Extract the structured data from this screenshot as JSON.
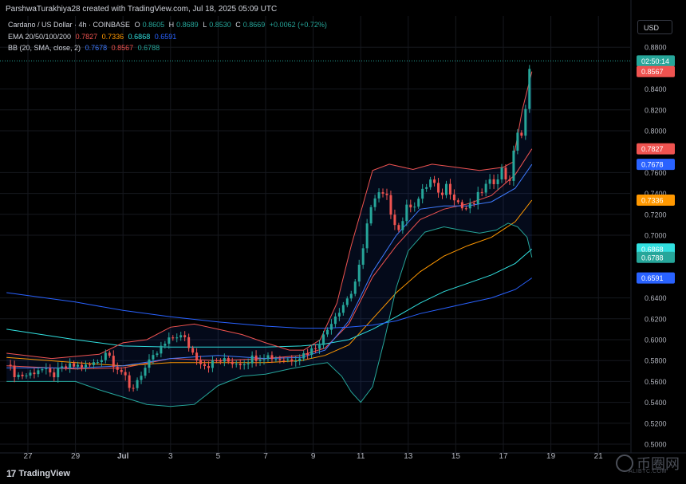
{
  "header": {
    "text": "ParshwaTurakhiya28 created with TradingView.com, Jul 18, 2025 05:09 UTC"
  },
  "legend": {
    "symbol": "Cardano / US Dollar · 4h · COINBASE",
    "o_label": "O",
    "o": "0.8605",
    "h_label": "H",
    "h": "0.8689",
    "l_label": "L",
    "l": "0.8530",
    "c_label": "C",
    "c": "0.8669",
    "change": "+0.0062 (+0.72%)",
    "ema_label": "EMA 20/50/100/200",
    "ema20": "0.7827",
    "ema50": "0.7336",
    "ema100": "0.6868",
    "ema200": "0.6591",
    "bb_label": "BB (20, SMA, close, 2)",
    "bb_basis": "0.7678",
    "bb_upper": "0.8567",
    "bb_lower": "0.6788"
  },
  "currency": "USD",
  "footer": {
    "logo_text": "TradingView",
    "logo_mark": "17"
  },
  "watermark": {
    "main": "币圈网",
    "sub": "ALIBTC.COM"
  },
  "colors": {
    "up": "#26a69a",
    "down": "#ef5350",
    "ema20": "#ef5350",
    "ema50": "#ff9800",
    "ema100": "#31e0e0",
    "ema200": "#2962ff",
    "bb_basis": "#3f7bff",
    "bb_upper": "#ef5350",
    "bb_lower": "#26a69a"
  },
  "chart_data": {
    "type": "candlestick",
    "title": "Cardano / US Dollar · 4h · COINBASE",
    "xlabel": "",
    "ylabel": "",
    "ylim": [
      0.49,
      0.895
    ],
    "y_ticks": [
      "0.8800",
      "0.8400",
      "0.8200",
      "0.8000",
      "0.7600",
      "0.7400",
      "0.7200",
      "0.7000",
      "0.6400",
      "0.6200",
      "0.6000",
      "0.5800",
      "0.5600",
      "0.5400",
      "0.5200",
      "0.5000"
    ],
    "x_tick_labels": [
      "27",
      "29",
      "Jul",
      "3",
      "5",
      "7",
      "9",
      "11",
      "13",
      "15",
      "17",
      "19",
      "21"
    ],
    "x_tick_days": [
      0,
      2,
      4,
      6,
      8,
      10,
      12,
      14,
      16,
      18,
      20,
      22,
      24
    ],
    "last_day": 21.2,
    "price_tags": [
      {
        "text": "02:50:14",
        "value": 0.8669,
        "color": "#26a69a"
      },
      {
        "text": "0.8567",
        "value": 0.8567,
        "color": "#ef5350"
      },
      {
        "text": "0.7827",
        "value": 0.7827,
        "color": "#ef5350"
      },
      {
        "text": "0.7678",
        "value": 0.7678,
        "color": "#2962ff"
      },
      {
        "text": "0.7336",
        "value": 0.7336,
        "color": "#ff9800"
      },
      {
        "text": "0.6868",
        "value": 0.6868,
        "color": "#31e0e0"
      },
      {
        "text": "0.6788",
        "value": 0.6788,
        "color": "#26a69a"
      },
      {
        "text": "0.6591",
        "value": 0.6591,
        "color": "#2962ff"
      }
    ],
    "close_path": [
      [
        -0.9,
        0.576
      ],
      [
        -0.5,
        0.566
      ],
      [
        0,
        0.566
      ],
      [
        0.5,
        0.573
      ],
      [
        1,
        0.565
      ],
      [
        1.5,
        0.573
      ],
      [
        2,
        0.575
      ],
      [
        2.5,
        0.574
      ],
      [
        3,
        0.58
      ],
      [
        3.3,
        0.59
      ],
      [
        3.6,
        0.578
      ],
      [
        4,
        0.568
      ],
      [
        4.3,
        0.55
      ],
      [
        4.7,
        0.566
      ],
      [
        5.2,
        0.58
      ],
      [
        5.6,
        0.592
      ],
      [
        6,
        0.6
      ],
      [
        6.3,
        0.605
      ],
      [
        6.6,
        0.6
      ],
      [
        7,
        0.585
      ],
      [
        7.5,
        0.575
      ],
      [
        8,
        0.58
      ],
      [
        8.5,
        0.579
      ],
      [
        9,
        0.578
      ],
      [
        9.5,
        0.583
      ],
      [
        10,
        0.585
      ],
      [
        10.5,
        0.582
      ],
      [
        11,
        0.581
      ],
      [
        11.5,
        0.585
      ],
      [
        12,
        0.591
      ],
      [
        12.5,
        0.605
      ],
      [
        12.8,
        0.62
      ],
      [
        13.2,
        0.632
      ],
      [
        13.6,
        0.645
      ],
      [
        13.9,
        0.665
      ],
      [
        14.1,
        0.685
      ],
      [
        14.3,
        0.72
      ],
      [
        14.5,
        0.73
      ],
      [
        14.8,
        0.74
      ],
      [
        15.1,
        0.735
      ],
      [
        15.3,
        0.72
      ],
      [
        15.6,
        0.705
      ],
      [
        16,
        0.73
      ],
      [
        16.3,
        0.73
      ],
      [
        16.7,
        0.745
      ],
      [
        17,
        0.755
      ],
      [
        17.3,
        0.735
      ],
      [
        17.6,
        0.748
      ],
      [
        18,
        0.735
      ],
      [
        18.3,
        0.725
      ],
      [
        18.7,
        0.728
      ],
      [
        19,
        0.74
      ],
      [
        19.3,
        0.748
      ],
      [
        19.6,
        0.752
      ],
      [
        20,
        0.765
      ],
      [
        20.2,
        0.745
      ],
      [
        20.4,
        0.773
      ],
      [
        20.6,
        0.8
      ],
      [
        20.8,
        0.795
      ],
      [
        21,
        0.83
      ],
      [
        21.1,
        0.857
      ],
      [
        21.2,
        0.8669
      ]
    ],
    "series": [
      {
        "name": "EMA 20",
        "key": "ema20",
        "values": [
          [
            -0.9,
            0.575
          ],
          [
            2,
            0.572
          ],
          [
            4,
            0.573
          ],
          [
            6,
            0.582
          ],
          [
            8,
            0.58
          ],
          [
            10,
            0.582
          ],
          [
            11.5,
            0.585
          ],
          [
            12.5,
            0.592
          ],
          [
            13.5,
            0.615
          ],
          [
            14.5,
            0.66
          ],
          [
            15.5,
            0.69
          ],
          [
            16.5,
            0.715
          ],
          [
            17.5,
            0.725
          ],
          [
            18.5,
            0.73
          ],
          [
            19.5,
            0.738
          ],
          [
            20.5,
            0.758
          ],
          [
            21.2,
            0.7827
          ]
        ]
      },
      {
        "name": "EMA 50",
        "key": "ema50",
        "values": [
          [
            -0.9,
            0.583
          ],
          [
            2,
            0.578
          ],
          [
            4,
            0.575
          ],
          [
            6,
            0.578
          ],
          [
            8,
            0.578
          ],
          [
            10,
            0.578
          ],
          [
            11.5,
            0.58
          ],
          [
            12.5,
            0.585
          ],
          [
            13.5,
            0.595
          ],
          [
            14.5,
            0.62
          ],
          [
            15.5,
            0.645
          ],
          [
            16.5,
            0.665
          ],
          [
            17.5,
            0.68
          ],
          [
            18.5,
            0.69
          ],
          [
            19.5,
            0.698
          ],
          [
            20.5,
            0.713
          ],
          [
            21.2,
            0.7336
          ]
        ]
      },
      {
        "name": "EMA 100",
        "key": "ema100",
        "values": [
          [
            -0.9,
            0.61
          ],
          [
            2,
            0.6
          ],
          [
            4,
            0.594
          ],
          [
            6,
            0.593
          ],
          [
            8,
            0.593
          ],
          [
            10,
            0.593
          ],
          [
            11.5,
            0.594
          ],
          [
            12.5,
            0.596
          ],
          [
            13.5,
            0.6
          ],
          [
            14.5,
            0.61
          ],
          [
            15.5,
            0.622
          ],
          [
            16.5,
            0.635
          ],
          [
            17.5,
            0.646
          ],
          [
            18.5,
            0.654
          ],
          [
            19.5,
            0.662
          ],
          [
            20.5,
            0.673
          ],
          [
            21.2,
            0.6868
          ]
        ]
      },
      {
        "name": "EMA 200",
        "key": "ema200",
        "values": [
          [
            -0.9,
            0.645
          ],
          [
            2,
            0.636
          ],
          [
            4,
            0.628
          ],
          [
            6,
            0.622
          ],
          [
            8,
            0.617
          ],
          [
            10,
            0.613
          ],
          [
            11.5,
            0.611
          ],
          [
            12.5,
            0.611
          ],
          [
            13.5,
            0.612
          ],
          [
            14.5,
            0.614
          ],
          [
            15.5,
            0.618
          ],
          [
            16.5,
            0.625
          ],
          [
            17.5,
            0.63
          ],
          [
            18.5,
            0.635
          ],
          [
            19.5,
            0.64
          ],
          [
            20.5,
            0.648
          ],
          [
            21.2,
            0.6591
          ]
        ]
      },
      {
        "name": "BB basis",
        "key": "bb_basis",
        "values": [
          [
            -0.9,
            0.573
          ],
          [
            2,
            0.573
          ],
          [
            4,
            0.575
          ],
          [
            6,
            0.582
          ],
          [
            8,
            0.585
          ],
          [
            10,
            0.582
          ],
          [
            11.5,
            0.583
          ],
          [
            12.5,
            0.59
          ],
          [
            13.5,
            0.618
          ],
          [
            14.5,
            0.665
          ],
          [
            15.5,
            0.7
          ],
          [
            16.5,
            0.725
          ],
          [
            17.5,
            0.728
          ],
          [
            18.5,
            0.728
          ],
          [
            19.5,
            0.732
          ],
          [
            20.5,
            0.745
          ],
          [
            21.2,
            0.7678
          ]
        ]
      },
      {
        "name": "BB upper",
        "key": "bb_upper",
        "values": [
          [
            -0.9,
            0.587
          ],
          [
            1,
            0.582
          ],
          [
            3,
            0.586
          ],
          [
            4,
            0.597
          ],
          [
            5,
            0.6
          ],
          [
            6,
            0.612
          ],
          [
            7,
            0.615
          ],
          [
            8,
            0.61
          ],
          [
            9,
            0.605
          ],
          [
            10,
            0.597
          ],
          [
            11,
            0.59
          ],
          [
            11.6,
            0.59
          ],
          [
            12.3,
            0.6
          ],
          [
            13,
            0.635
          ],
          [
            13.6,
            0.69
          ],
          [
            14.1,
            0.73
          ],
          [
            14.5,
            0.762
          ],
          [
            15.2,
            0.768
          ],
          [
            16.2,
            0.763
          ],
          [
            17,
            0.768
          ],
          [
            18,
            0.765
          ],
          [
            19,
            0.762
          ],
          [
            20,
            0.765
          ],
          [
            20.4,
            0.77
          ],
          [
            20.8,
            0.82
          ],
          [
            21.2,
            0.8567
          ]
        ]
      },
      {
        "name": "BB lower",
        "key": "bb_lower",
        "values": [
          [
            -0.9,
            0.56
          ],
          [
            1,
            0.56
          ],
          [
            2,
            0.56
          ],
          [
            3,
            0.552
          ],
          [
            4,
            0.545
          ],
          [
            5,
            0.538
          ],
          [
            6,
            0.536
          ],
          [
            7,
            0.538
          ],
          [
            8,
            0.556
          ],
          [
            9,
            0.565
          ],
          [
            10,
            0.567
          ],
          [
            11,
            0.572
          ],
          [
            12,
            0.576
          ],
          [
            12.6,
            0.578
          ],
          [
            13.2,
            0.565
          ],
          [
            13.6,
            0.55
          ],
          [
            14,
            0.54
          ],
          [
            14.5,
            0.555
          ],
          [
            15,
            0.6
          ],
          [
            15.5,
            0.65
          ],
          [
            16,
            0.685
          ],
          [
            16.7,
            0.703
          ],
          [
            17.5,
            0.708
          ],
          [
            18.2,
            0.705
          ],
          [
            19,
            0.702
          ],
          [
            19.7,
            0.705
          ],
          [
            20.2,
            0.7115
          ],
          [
            20.6,
            0.708
          ],
          [
            21,
            0.698
          ],
          [
            21.2,
            0.6788
          ]
        ]
      }
    ]
  }
}
